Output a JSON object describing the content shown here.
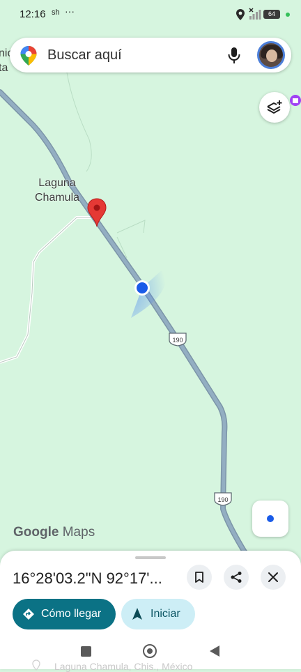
{
  "status_bar": {
    "time": "12:16",
    "carrier_hint": "sh",
    "more": "···",
    "battery": "64"
  },
  "search": {
    "placeholder": "Buscar aquí"
  },
  "map": {
    "place_label_line1": "Laguna",
    "place_label_line2": "Chamula",
    "edge_label_line1": "nic",
    "edge_label_line2": "ta",
    "route_shield_1": "190",
    "route_shield_2": "190",
    "logo_google": "Google",
    "logo_maps": "Maps"
  },
  "sheet": {
    "coordinates": "16°28'03.2\"N 92°17'...",
    "directions_label": "Cómo llegar",
    "start_label": "Iniciar",
    "faded_address": "Laguna Chamula, Chis., México"
  },
  "colors": {
    "map_bg": "#d6f5df",
    "road": "#8fa9bc",
    "accent": "#0b7285",
    "pin": "#e53935",
    "location_dot": "#1a5be8"
  }
}
